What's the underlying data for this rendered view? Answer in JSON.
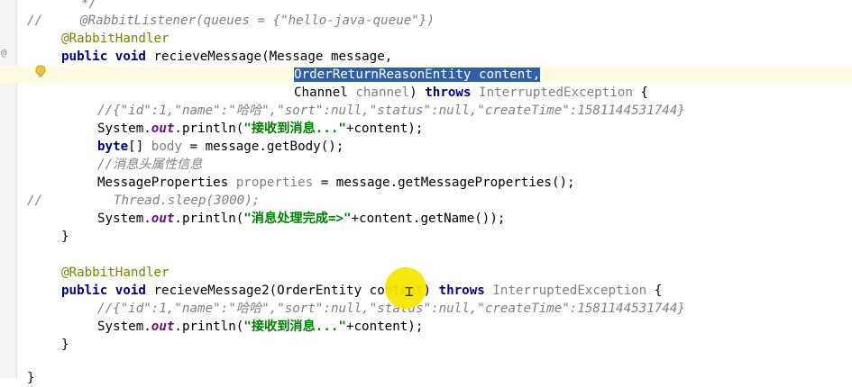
{
  "editor": {
    "lines": [
      "*/",
      "//",
      "@RabbitListener(queues = {\"hello-java-queue\"})",
      "@RabbitHandler",
      "public void recieveMessage(Message message,",
      "OrderReturnReasonEntity content,",
      "Channel channel) throws InterruptedException {",
      "//{\"id\":1,\"name\":\"哈哈\",\"sort\":null,\"status\":null,\"createTime\":1581144531744}",
      "System.out.println(\"接收到消息...\"+content);",
      "byte[] body = message.getBody();",
      "//消息头属性信息",
      "MessageProperties properties = message.getMessageProperties();",
      "//",
      "Thread.sleep(3000);",
      "System.out.println(\"消息处理完成=>\"+content.getName());",
      "}",
      "@RabbitHandler",
      "public void recieveMessage2(OrderEntity content) throws InterruptedException {",
      "//{\"id\":1,\"name\":\"哈哈\",\"sort\":null,\"status\":null,\"createTime\":1581144531744}",
      "System.out.println(\"接收到消息...\"+content);",
      "}",
      "}"
    ],
    "gutter_marker": "@",
    "colors": {
      "keyword": "#000080",
      "annotation": "#808000",
      "comment": "#808080",
      "string": "#008000",
      "selection": "#2f5fa8",
      "current_line": "#fffbe0",
      "cursor_highlight": "#f6e600"
    },
    "icons": [
      "lightbulb-icon",
      "text-cursor-icon"
    ]
  }
}
